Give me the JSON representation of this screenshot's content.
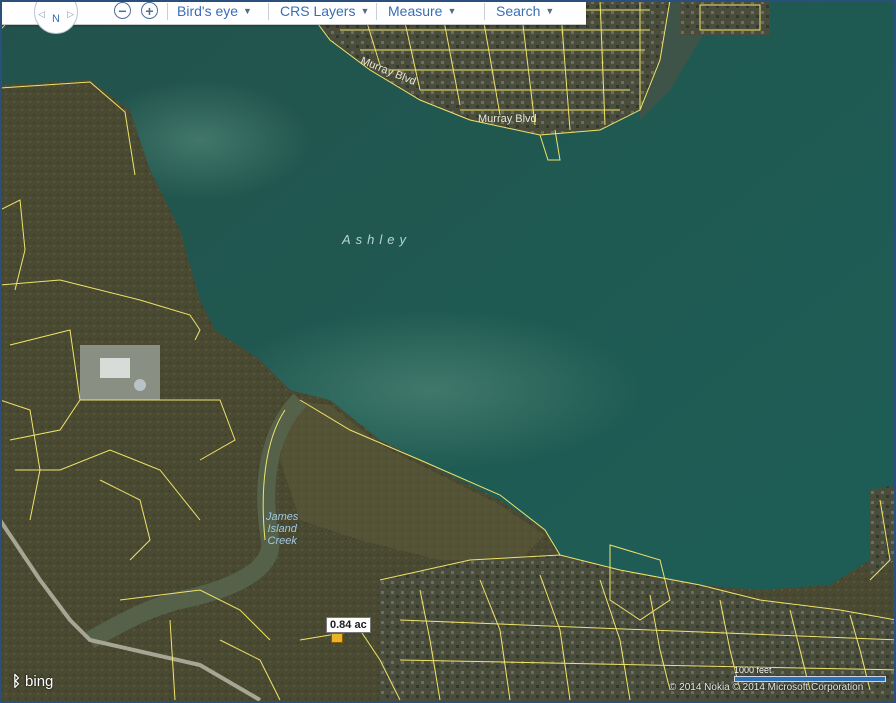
{
  "toolbar": {
    "compass_label": "N",
    "birds_eye_label": "Bird's eye",
    "crs_layers_label": "CRS Layers",
    "measure_label": "Measure",
    "search_label": "Search"
  },
  "map": {
    "water_label": "Ashley",
    "creek_label_line1": "James",
    "creek_label_line2": "Island",
    "creek_label_line3": "Creek",
    "street_label_1": "Murray Blvd",
    "street_label_2": "Murray Blvd",
    "parcel_area": "0.84 ac",
    "scale_label": "1000 feet"
  },
  "footer": {
    "logo_text": "bing",
    "copyright": "© 2014 Nokia   © 2014 Microsoft Corporation"
  },
  "colors": {
    "water": "#1f5850",
    "marsh": "#4a4a30",
    "parcel_lines": "#f0e36a",
    "accent": "#3a6db5"
  }
}
